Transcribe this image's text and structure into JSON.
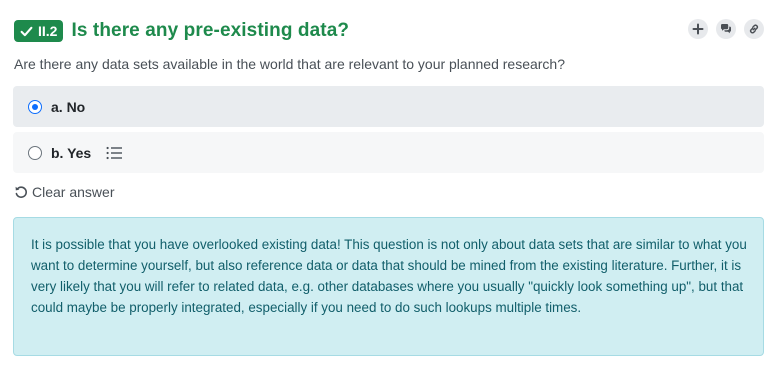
{
  "question": {
    "badge_label": "II.2",
    "title": "Is there any pre-existing data?",
    "description": "Are there any data sets available in the world that are relevant to your planned research?"
  },
  "actions": [
    {
      "icon": "plus-icon"
    },
    {
      "icon": "comments-icon"
    },
    {
      "icon": "link-icon"
    }
  ],
  "options": [
    {
      "label": "a. No",
      "selected": true
    },
    {
      "label": "b. Yes",
      "selected": false,
      "has_followups_icon": "list-icon"
    }
  ],
  "clear_answer": {
    "label": "Clear answer",
    "icon": "undo-icon"
  },
  "info_text": "It is possible that you have overlooked existing data! This question is not only about data sets that are similar to what you want to determine yourself, but also reference data or data that should be mined from the existing literature. Further, it is very likely that you will refer to related data, e.g. other databases where you usually \"quickly look something up\", but that could maybe be properly integrated, especially if you need to do such lookups multiple times.",
  "colors": {
    "accent_green": "#1e8a4c",
    "selected_bg": "#e9ecef",
    "radio_blue": "#0d6efd",
    "info_bg": "#d0eef2",
    "info_text": "#115e6a"
  }
}
